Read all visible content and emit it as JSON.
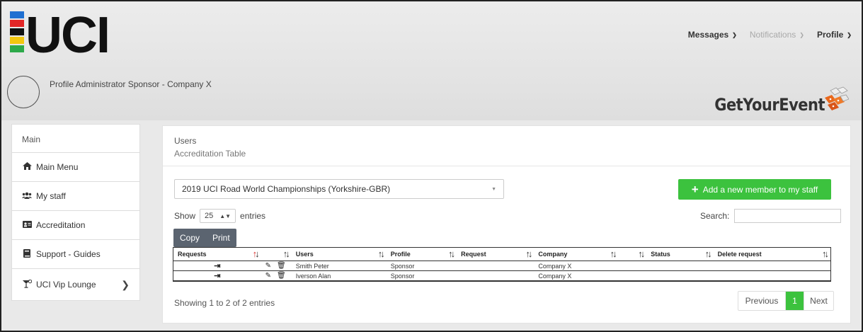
{
  "brand": {
    "logo_text": "UCI",
    "partner_logo_text": "GetYourEvent"
  },
  "topnav": {
    "messages": "Messages",
    "notifications": "Notifications",
    "profile": "Profile"
  },
  "user": {
    "profile_name": "Profile Administrator Sponsor - Company X"
  },
  "sidebar": {
    "header": "Main",
    "items": [
      {
        "label": "Main Menu",
        "icon": "home-icon"
      },
      {
        "label": "My staff",
        "icon": "users-icon"
      },
      {
        "label": "Accreditation",
        "icon": "id-card-icon"
      },
      {
        "label": "Support - Guides",
        "icon": "book-icon"
      },
      {
        "label": "UCI Vip Lounge",
        "icon": "cocktail-icon"
      }
    ]
  },
  "main": {
    "title": "Users",
    "subtitle": "Accreditation Table",
    "event_select": "2019 UCI Road World Championships (Yorkshire-GBR)",
    "add_button": "Add a new member to my staff",
    "show_label": "Show",
    "entries_value": "25",
    "entries_label": "entries",
    "search_label": "Search:",
    "search_value": "",
    "copy_button": "Copy",
    "print_button": "Print",
    "columns": [
      "Requests",
      "",
      "Users",
      "Profile",
      "Request",
      "Company",
      "",
      "Status",
      "Delete request"
    ],
    "rows": [
      {
        "user": "Smith Peter",
        "profile": "Sponsor",
        "company": "Company X"
      },
      {
        "user": "Iverson Alan",
        "profile": "Sponsor",
        "company": "Company X"
      }
    ],
    "info": "Showing 1 to 2 of 2 entries",
    "pager": {
      "previous": "Previous",
      "current": "1",
      "next": "Next"
    }
  },
  "colors": {
    "accent_green": "#3cc23e",
    "button_dark": "#5b6470",
    "sort_active": "#d9302c"
  }
}
